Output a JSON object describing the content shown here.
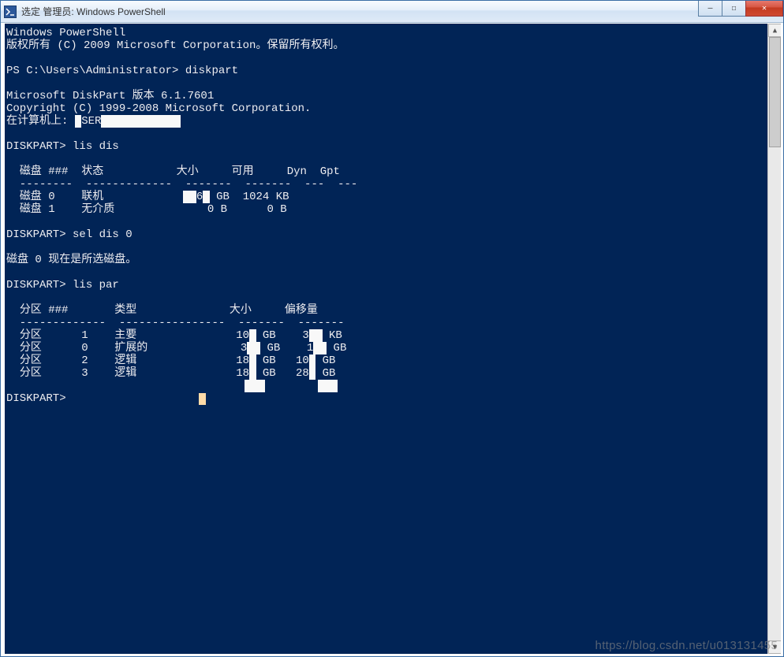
{
  "window": {
    "title": "选定 管理员: Windows PowerShell"
  },
  "controls": {
    "min_glyph": "—",
    "max_glyph": "☐",
    "close_glyph": "✕",
    "scroll_up_glyph": "▲",
    "scroll_down_glyph": "▼"
  },
  "console": {
    "ps_header1": "Windows PowerShell",
    "ps_header2": "版权所有 (C) 2009 Microsoft Corporation。保留所有权利。",
    "prompt1_path": "PS C:\\Users\\Administrator> ",
    "prompt1_cmd": "diskpart",
    "dp_version": "Microsoft DiskPart 版本 6.1.7601",
    "dp_copyright": "Copyright (C) 1999-2008 Microsoft Corporation.",
    "on_computer_label": "在计算机上: ",
    "on_computer_value_visible": "SER",
    "dp_prompt": "DISKPART> ",
    "cmd_lis_dis": "lis dis",
    "cmd_sel_dis_0": "sel dis 0",
    "cmd_lis_par": "lis par",
    "sel_dis_result": "磁盘 0 现在是所选磁盘。",
    "disk_table": {
      "headers": {
        "disk_num": "磁盘 ###",
        "status": "状态",
        "size": "大小",
        "free": "可用",
        "dyn": "Dyn",
        "gpt": "Gpt"
      },
      "rows": [
        {
          "disk": "磁盘 0",
          "status": "联机",
          "size_visible": "6",
          "size_unit": "GB",
          "free": "1024 KB"
        },
        {
          "disk": "磁盘 1",
          "status": "无介质",
          "size": "0 B",
          "free": "0 B"
        }
      ]
    },
    "par_table": {
      "headers": {
        "par_num": "分区 ###",
        "type": "类型",
        "size": "大小",
        "offset": "偏移量"
      },
      "rows": [
        {
          "par": "分区",
          "num": "1",
          "type": "主要",
          "size_v": "10",
          "size_u": "GB",
          "off_v": "3",
          "off_u": "KB"
        },
        {
          "par": "分区",
          "num": "0",
          "type": "扩展的",
          "size_v": "3",
          "size_u": "GB",
          "off_v": "1",
          "off_u": "GB"
        },
        {
          "par": "分区",
          "num": "2",
          "type": "逻辑",
          "size_v": "18",
          "size_u": "GB",
          "off_v": "10",
          "off_u": "GB"
        },
        {
          "par": "分区",
          "num": "3",
          "type": "逻辑",
          "size_v": "18",
          "size_u": "GB",
          "off_v": "28",
          "off_u": "GB"
        }
      ]
    }
  },
  "watermark": "https://blog.csdn.net/u013131455"
}
